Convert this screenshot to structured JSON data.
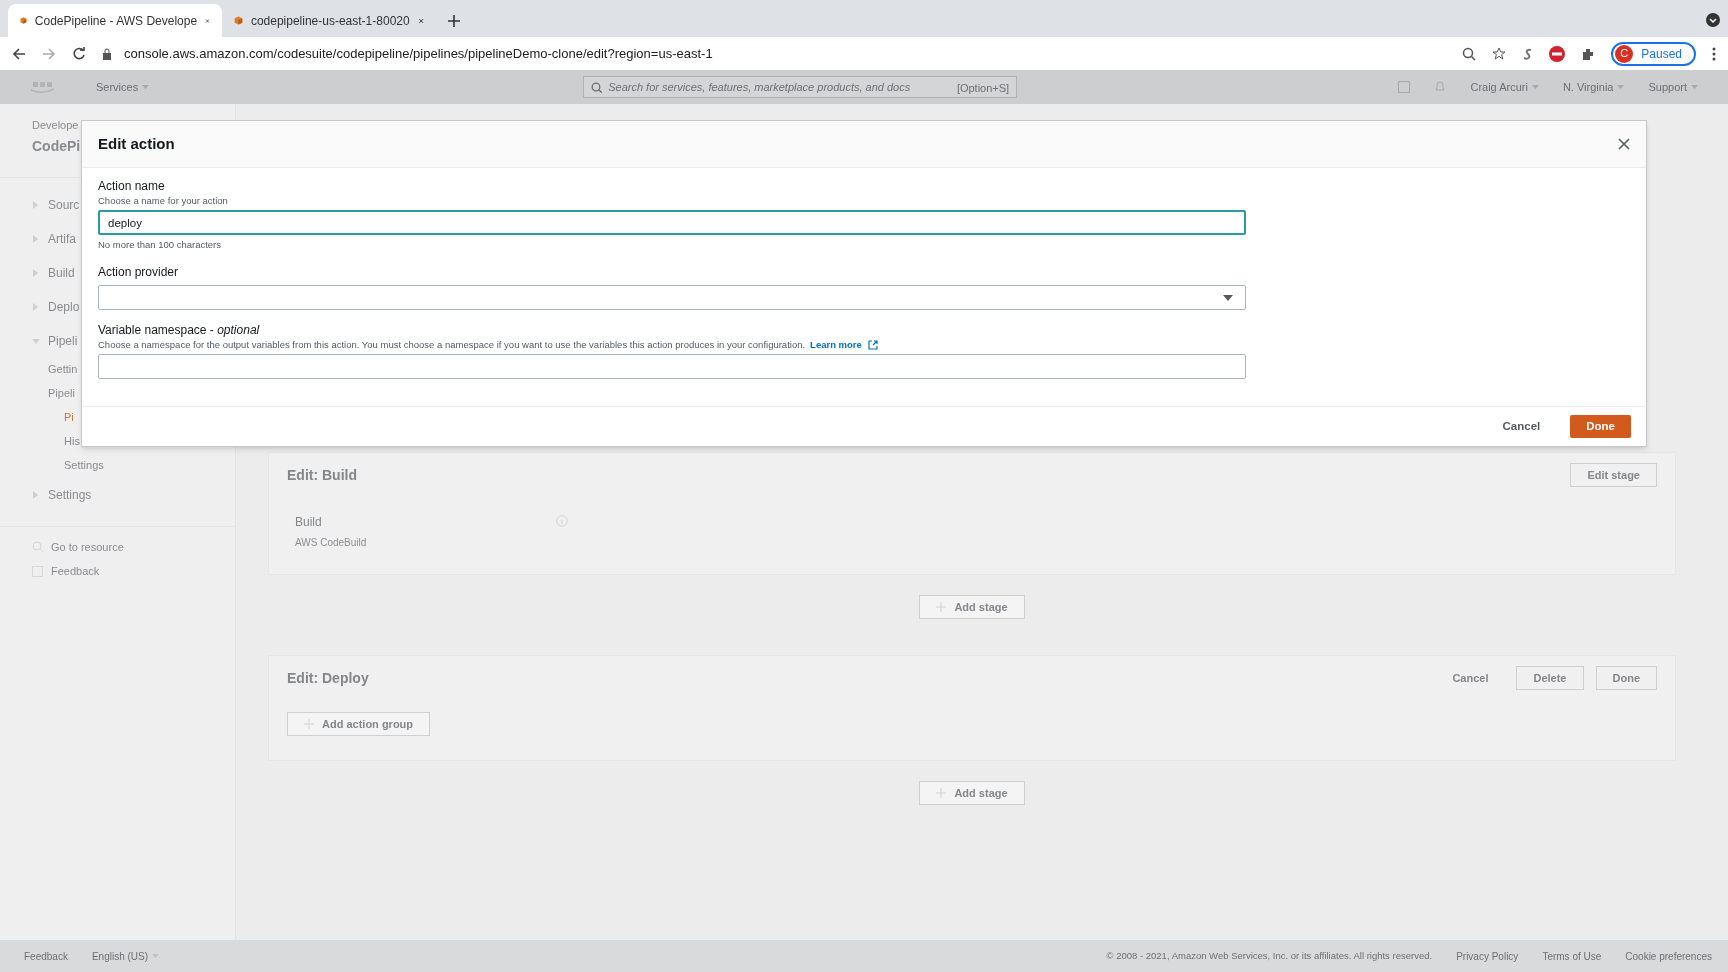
{
  "browser": {
    "tabs": [
      {
        "title": "CodePipeline - AWS Develope",
        "selected": true
      },
      {
        "title": "codepipeline-us-east-1-80020",
        "selected": false
      }
    ],
    "url": "console.aws.amazon.com/codesuite/codepipeline/pipelines/pipelineDemo-clone/edit?region=us-east-1",
    "profile_button": "Paused",
    "profile_initial": "C"
  },
  "aws_nav": {
    "services": "Services",
    "search_placeholder": "Search for services, features, marketplace products, and docs",
    "shortcut": "[Option+S]",
    "account": "Craig Arcuri",
    "region": "N. Virginia",
    "support": "Support"
  },
  "sidebar": {
    "breadcrumb": "Develope",
    "title": "CodePi",
    "items": [
      {
        "label": "Sourc",
        "expanded": false,
        "selected": false
      },
      {
        "label": "Artifa",
        "expanded": false,
        "selected": false
      },
      {
        "label": "Build",
        "expanded": false,
        "selected": false
      },
      {
        "label": "Deplo",
        "expanded": false,
        "selected": false
      },
      {
        "label": "Pipeli",
        "expanded": true,
        "selected": false,
        "children": [
          {
            "label": "Gettin",
            "selected": false
          },
          {
            "label": "Pipeli",
            "selected": false,
            "children": [
              {
                "label": "Pi",
                "selected": true
              },
              {
                "label": "His",
                "selected": false
              },
              {
                "label": "Settings",
                "selected": false
              }
            ]
          }
        ]
      },
      {
        "label": "Settings",
        "expanded": false,
        "selected": false
      }
    ],
    "tools": [
      "Go to resource",
      "Feedback"
    ]
  },
  "main": [
    {
      "kind": "stage",
      "title": "Edit: Build",
      "buttons": [
        "Edit stage"
      ],
      "actions": [
        {
          "name": "Build",
          "provider": "AWS CodeBuild"
        }
      ]
    },
    {
      "kind": "add_stage",
      "label": "Add stage"
    },
    {
      "kind": "stage",
      "title": "Edit: Deploy",
      "buttons": [
        "Cancel",
        "Delete",
        "Done"
      ],
      "add_action_group": "Add action group"
    },
    {
      "kind": "add_stage",
      "label": "Add stage"
    }
  ],
  "modal": {
    "title": "Edit action",
    "fields": [
      {
        "kind": "text",
        "label": "Action name",
        "description": "Choose a name for your action",
        "value": "deploy",
        "hint": "No more than 100 characters",
        "focused": true
      },
      {
        "kind": "select",
        "label": "Action provider",
        "focused": false
      },
      {
        "kind": "text",
        "label": "Variable namespace - ",
        "label_suffix": "optional",
        "description": "Choose a namespace for the output variables from this action. You must choose a namespace if you want to use the variables this action produces in your configuration.",
        "link": "Learn more",
        "focused": false
      }
    ],
    "buttons": [
      {
        "label": "Cancel",
        "kind": "secondary"
      },
      {
        "label": "Done",
        "kind": "primary"
      }
    ]
  },
  "footer": {
    "left": [
      "Feedback",
      "English (US)"
    ],
    "copyright": "© 2008 - 2021, Amazon Web Services, Inc. or its affiliates. All rights reserved.",
    "links": [
      "Privacy Policy",
      "Terms of Use",
      "Cookie preferences"
    ]
  }
}
